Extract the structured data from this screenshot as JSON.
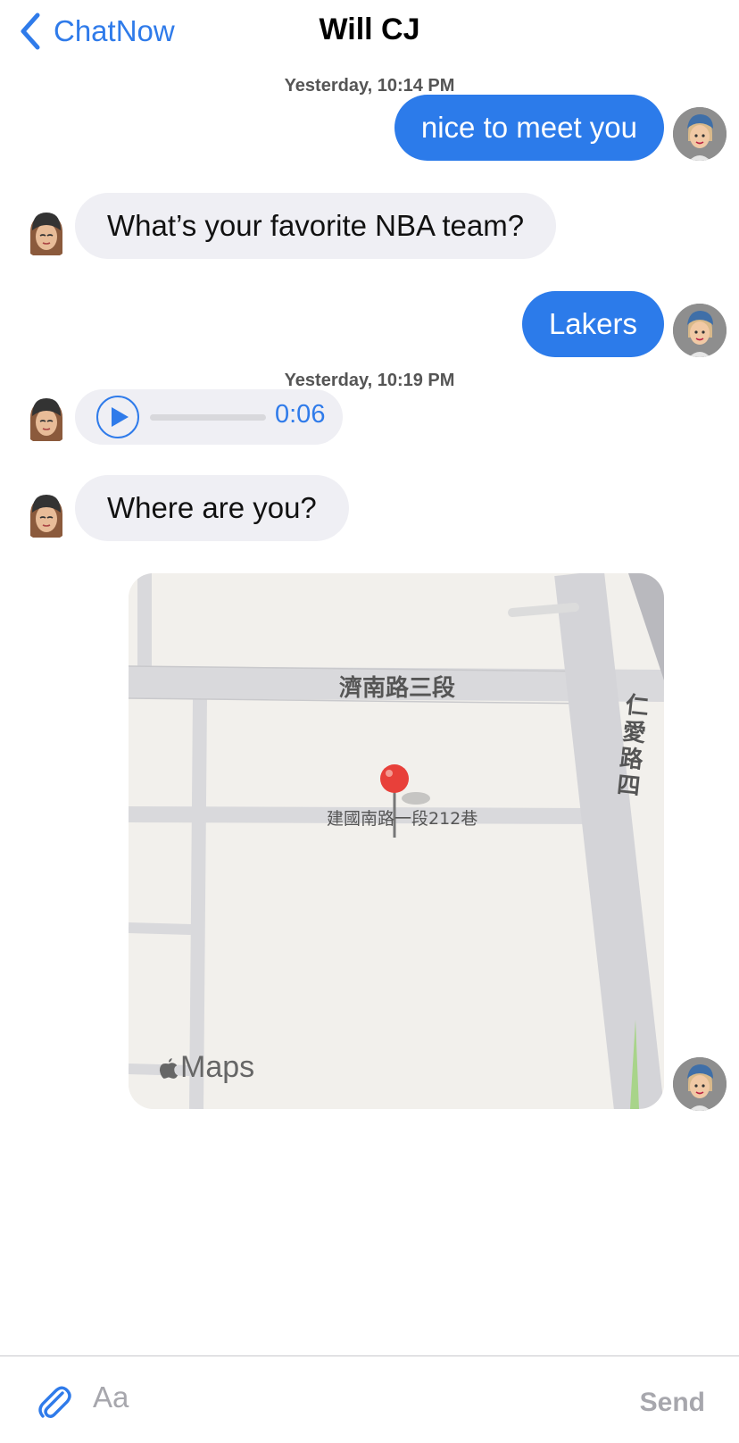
{
  "header": {
    "back_label": "ChatNow",
    "title": "Will CJ"
  },
  "messages": [
    {
      "timestamp": "Yesterday, 10:14 PM",
      "direction": "outgoing",
      "type": "text",
      "text": "nice to meet you"
    },
    {
      "direction": "incoming",
      "type": "text",
      "text": "What’s your favorite NBA team?"
    },
    {
      "direction": "outgoing",
      "type": "text",
      "text": "Lakers"
    },
    {
      "timestamp": "Yesterday, 10:19 PM",
      "direction": "incoming",
      "type": "audio",
      "duration": "0:06"
    },
    {
      "direction": "incoming",
      "type": "text",
      "text": "Where are you?"
    },
    {
      "direction": "outgoing",
      "type": "map",
      "street_main": "濟南路三段",
      "street_side": "仁愛路四",
      "pin_label": "建國南路一段212巷",
      "brand": "Maps"
    }
  ],
  "composer": {
    "placeholder": "Aa",
    "send_label": "Send"
  },
  "colors": {
    "accent": "#2c7bea",
    "incoming_bubble": "#efeff4",
    "pin": "#e8403a"
  },
  "icons": {
    "back": "chevron-left-icon",
    "play": "play-icon",
    "attach": "paperclip-icon",
    "apple": "apple-logo-icon"
  }
}
